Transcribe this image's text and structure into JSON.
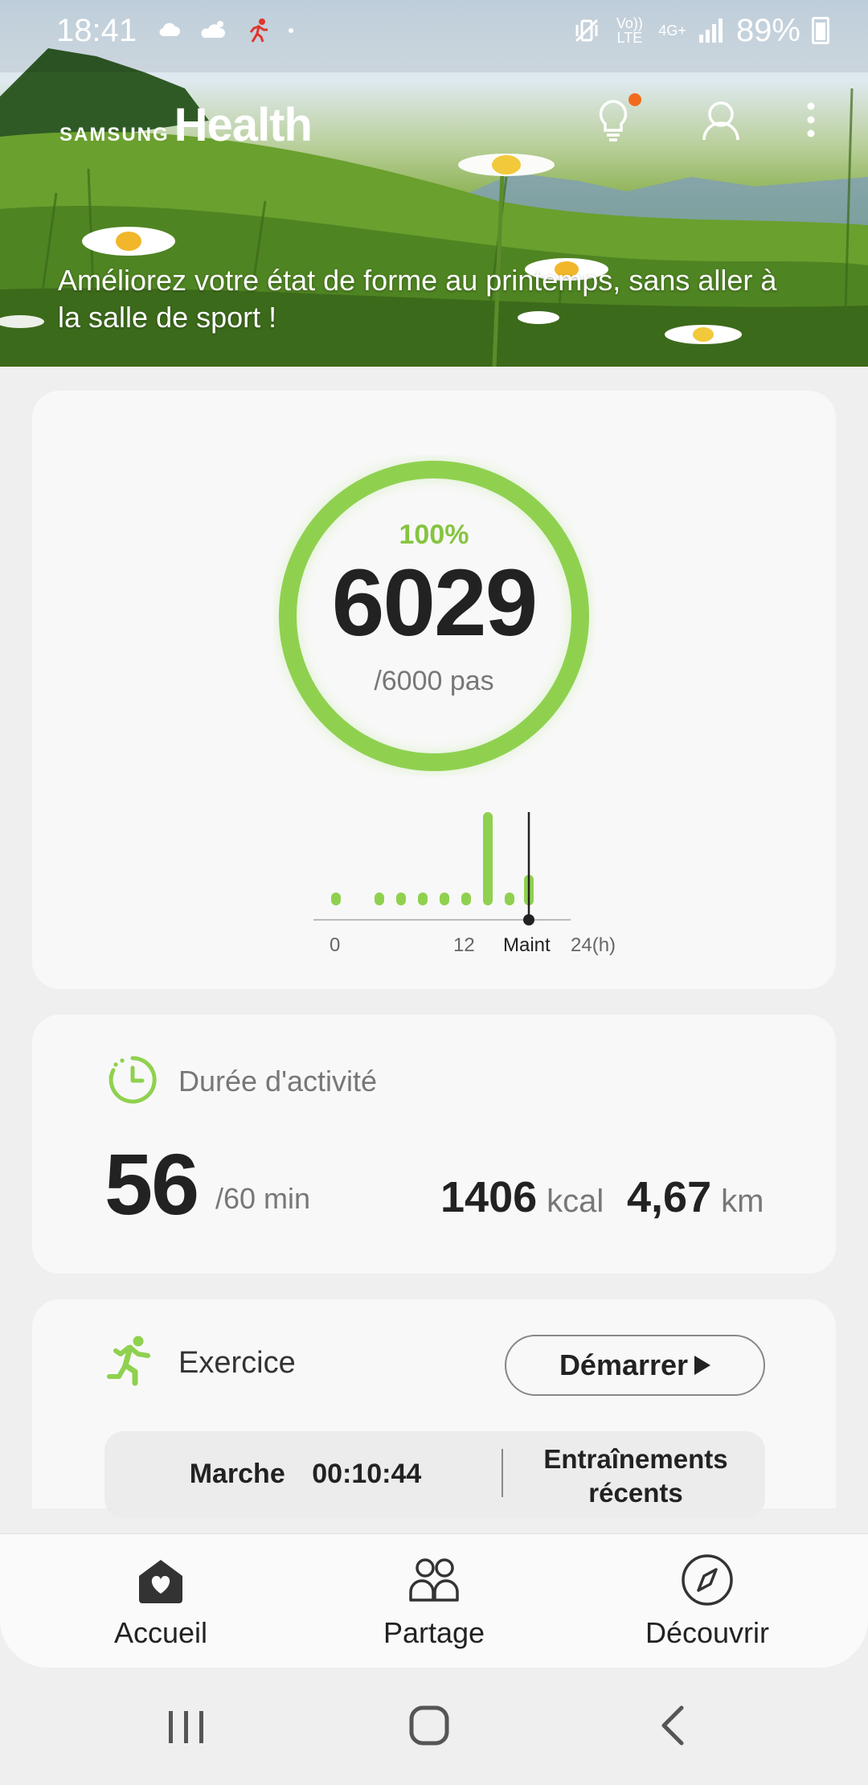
{
  "status_bar": {
    "time": "18:41",
    "network_volte": "Vo)) LTE",
    "network_4g": "4G+",
    "battery": "89%"
  },
  "header": {
    "brand_samsung": "SAMSUNG",
    "brand_health": "Health",
    "promo_text": "Améliorez votre état de forme au printemps, sans aller à la salle de sport !"
  },
  "steps": {
    "percent": "100%",
    "count": "6029",
    "goal": "/6000 pas",
    "progress": 1.0,
    "accent": "#8fd14f",
    "hourly_labels": {
      "start": "0",
      "mid": "12",
      "now": "Maint",
      "end": "24(h)"
    }
  },
  "activity": {
    "title": "Durée d'activité",
    "minutes": "56",
    "goal": "/60 min",
    "kcal_value": "1406",
    "kcal_unit": "kcal",
    "km_value": "4,67",
    "km_unit": "km"
  },
  "exercise": {
    "title": "Exercice",
    "start_label": "Démarrer",
    "last_type": "Marche",
    "last_duration": "00:10:44",
    "recent_line1": "Entraînements",
    "recent_line2": "récents"
  },
  "bottom_nav": {
    "home": "Accueil",
    "share": "Partage",
    "discover": "Découvrir"
  }
}
